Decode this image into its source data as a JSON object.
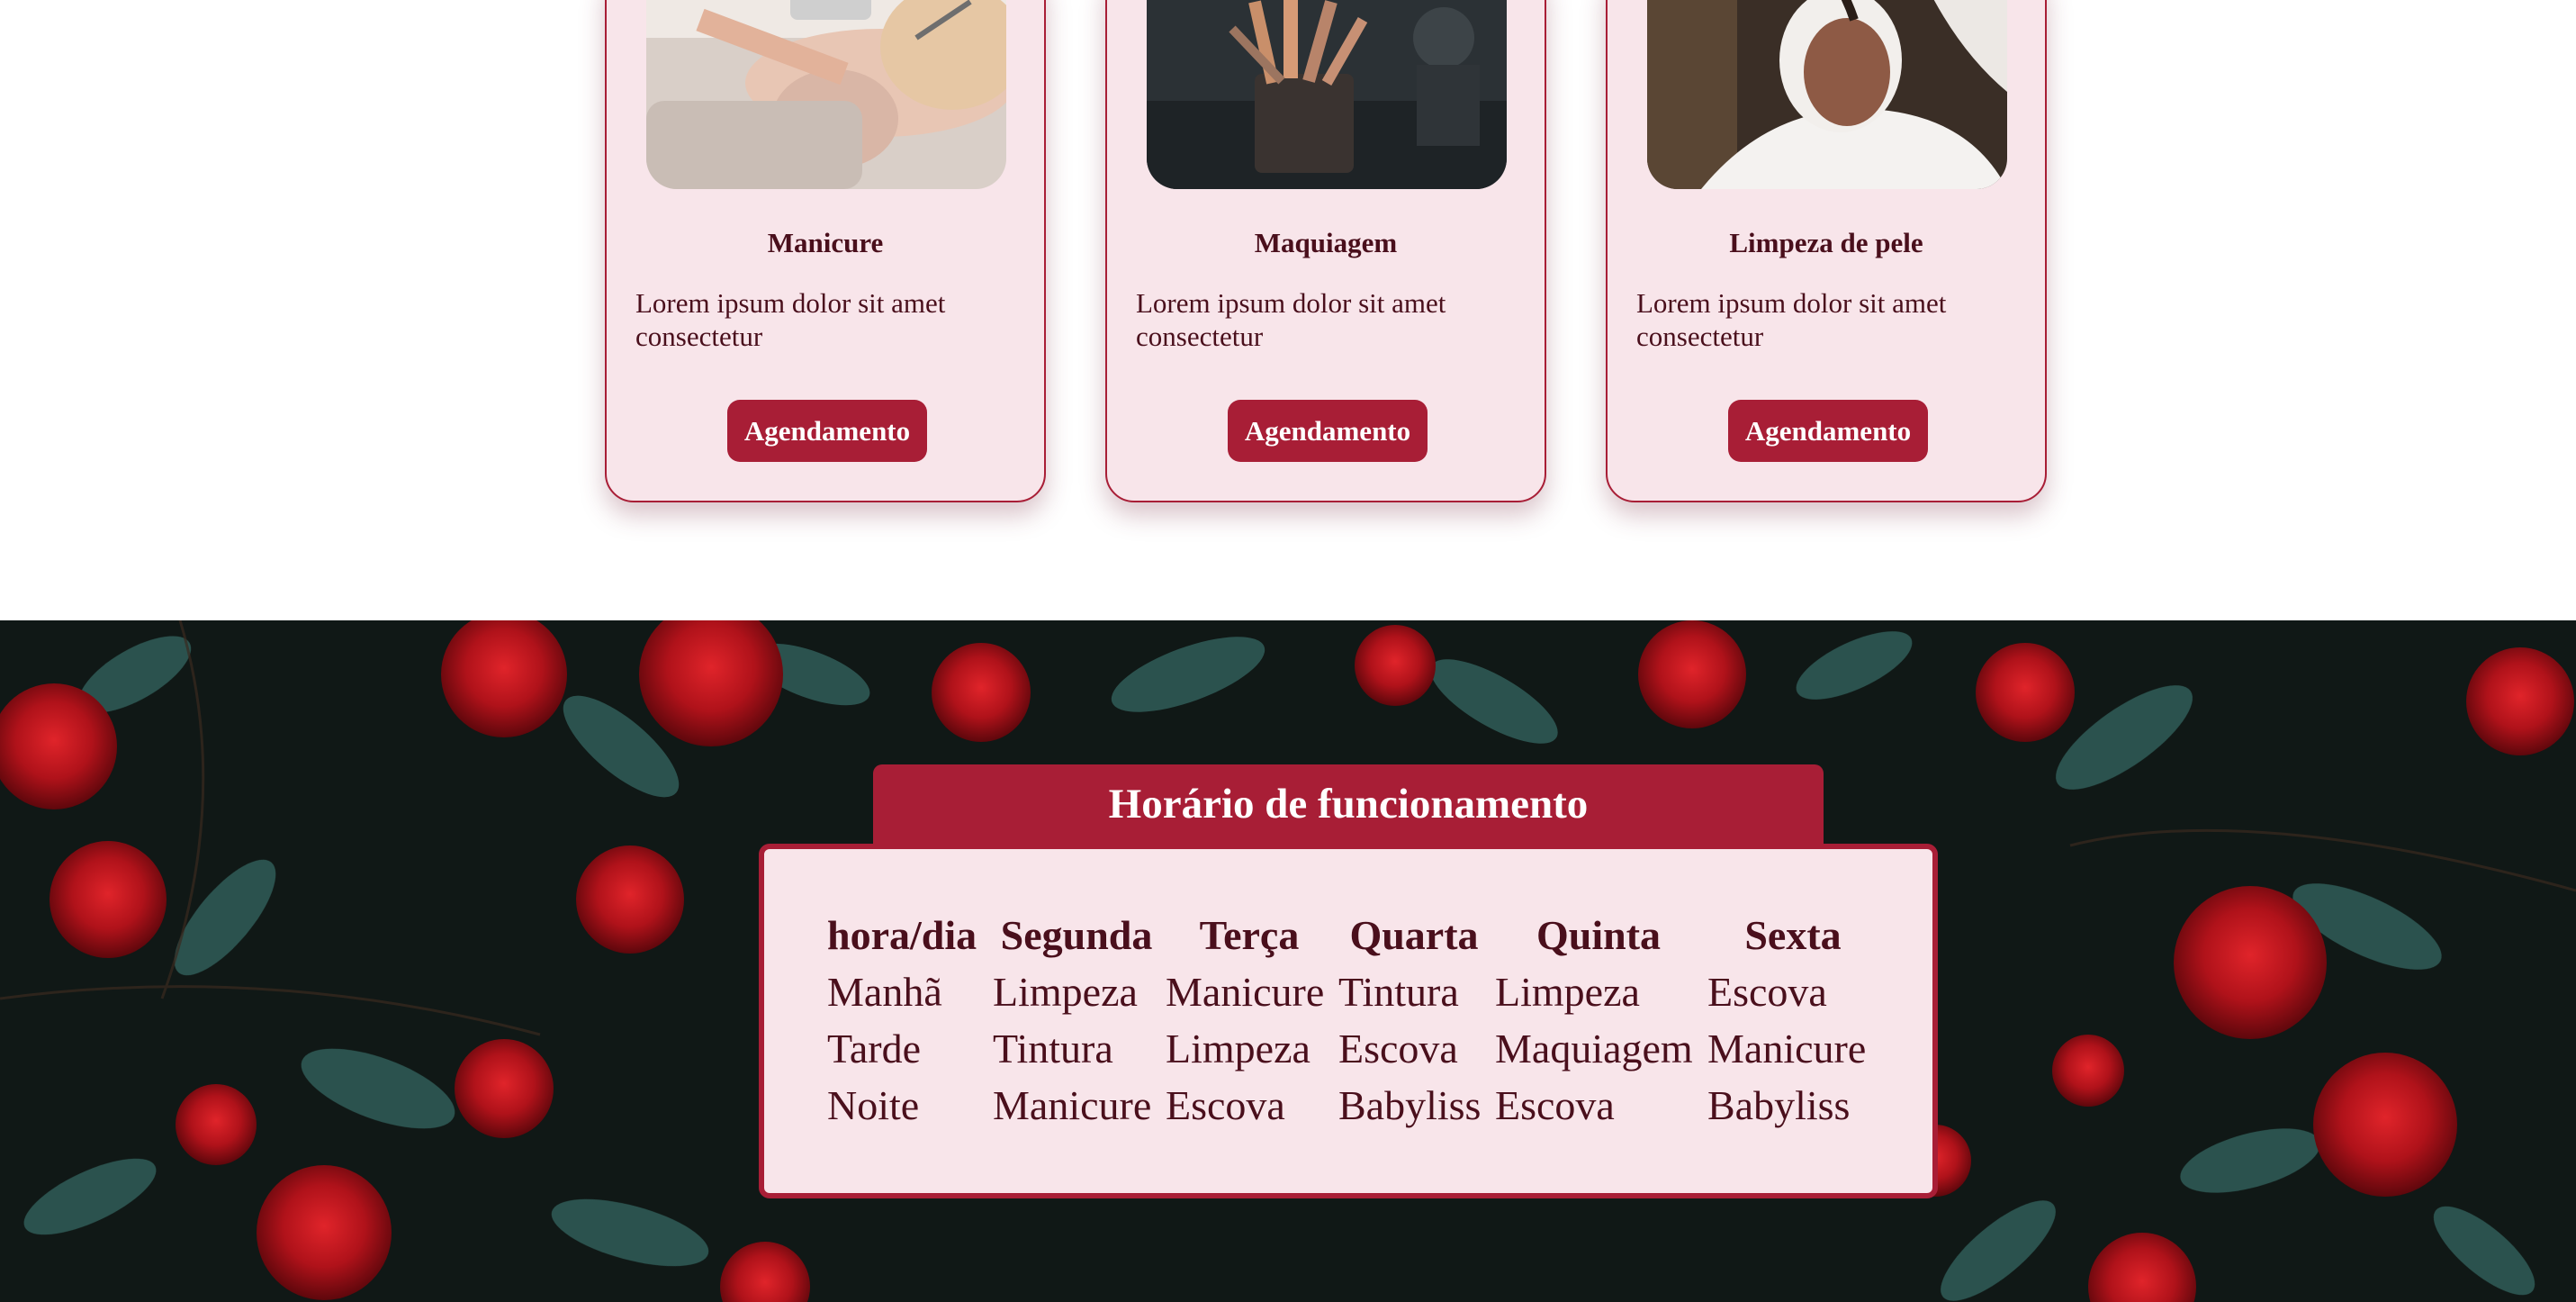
{
  "services": [
    {
      "title": "Manicure",
      "description": "Lorem ipsum dolor sit amet consectetur",
      "button": "Agendamento",
      "image": "manicure-photo"
    },
    {
      "title": "Maquiagem",
      "description": "Lorem ipsum dolor sit amet consectetur",
      "button": "Agendamento",
      "image": "makeup-brushes-photo"
    },
    {
      "title": "Limpeza de pele",
      "description": "Lorem ipsum dolor sit amet consectetur",
      "button": "Agendamento",
      "image": "facial-treatment-photo"
    }
  ],
  "hours": {
    "title": "Horário de funcionamento",
    "background": "red-roses-photo",
    "headers": [
      "hora/dia",
      "Segunda",
      "Terça",
      "Quarta",
      "Quinta",
      "Sexta"
    ],
    "rows": [
      [
        "Manhã",
        "Limpeza",
        "Manicure",
        "Tintura",
        "Limpeza",
        "Escova"
      ],
      [
        "Tarde",
        "Tintura",
        "Limpeza",
        "Escova",
        "Maquiagem",
        "Manicure"
      ],
      [
        "Noite",
        "Manicure",
        "Escova",
        "Babyliss",
        "Escova",
        "Babyliss"
      ]
    ]
  },
  "colors": {
    "accent": "#a81e36",
    "card_bg": "#f8e5ea",
    "text": "#4a0f1c"
  }
}
